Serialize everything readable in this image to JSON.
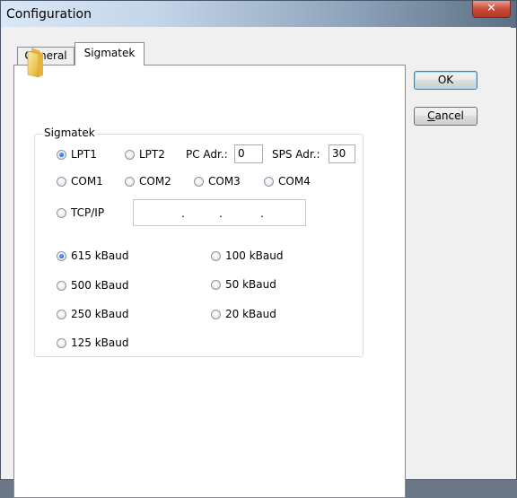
{
  "window": {
    "title": "Configuration"
  },
  "tabs": [
    {
      "label": "General"
    },
    {
      "label": "Sigmatek"
    }
  ],
  "buttons": {
    "ok": "OK",
    "cancel_prefix": "C",
    "cancel_rest": "ancel"
  },
  "sigmatek": {
    "group_title": "Sigmatek",
    "ports": [
      {
        "label": "LPT1",
        "checked": true
      },
      {
        "label": "LPT2",
        "checked": false
      },
      {
        "label": "COM1",
        "checked": false
      },
      {
        "label": "COM2",
        "checked": false
      },
      {
        "label": "COM3",
        "checked": false
      },
      {
        "label": "COM4",
        "checked": false
      },
      {
        "label": "TCP/IP",
        "checked": false
      }
    ],
    "pc_adr": {
      "label": "PC Adr.:",
      "value": "0"
    },
    "sps_adr": {
      "label": "SPS Adr.:",
      "value": "30"
    },
    "ip_separators": [
      ".",
      ".",
      "."
    ],
    "baud": [
      {
        "label": "615 kBaud",
        "checked": true
      },
      {
        "label": "500 kBaud",
        "checked": false
      },
      {
        "label": "250 kBaud",
        "checked": false
      },
      {
        "label": "125 kBaud",
        "checked": false
      },
      {
        "label": "100 kBaud",
        "checked": false
      },
      {
        "label": "50 kBaud",
        "checked": false
      },
      {
        "label": "20 kBaud",
        "checked": false
      }
    ]
  }
}
